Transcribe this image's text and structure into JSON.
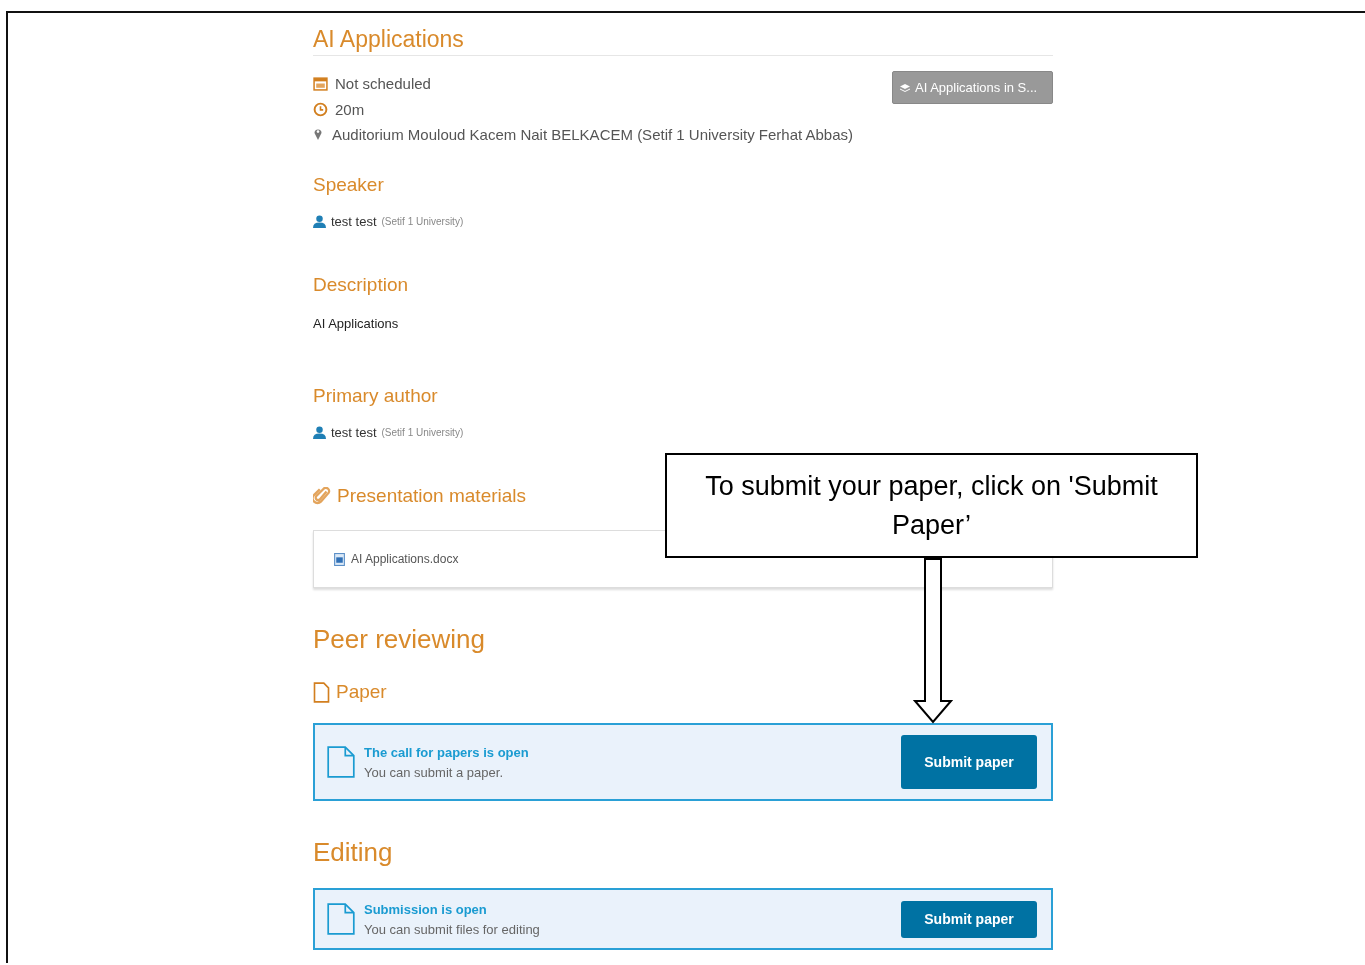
{
  "title": "AI Applications",
  "meta": {
    "date": "Not scheduled",
    "duration": "20m",
    "location": "Auditorium Mouloud Kacem Nait BELKACEM (Setif 1 University Ferhat Abbas)"
  },
  "session_button": "AI Applications in S...",
  "speaker": {
    "heading": "Speaker",
    "name": "test test",
    "affiliation": "(Setif 1 University)"
  },
  "description": {
    "heading": "Description",
    "text": "AI Applications"
  },
  "primary_author": {
    "heading": "Primary author",
    "name": "test test",
    "affiliation": "(Setif 1 University)"
  },
  "materials": {
    "heading": "Presentation materials",
    "file": "AI Applications.docx"
  },
  "peer_reviewing": {
    "heading": "Peer reviewing",
    "subheading": "Paper",
    "box": {
      "title": "The call for papers is open",
      "text": "You can submit a paper.",
      "button": "Submit paper"
    }
  },
  "editing": {
    "heading": "Editing",
    "box": {
      "title": "Submission is open",
      "text": "You can submit files for editing",
      "button": "Submit paper"
    }
  },
  "callout": "To submit your paper, click on 'Submit Paper’"
}
